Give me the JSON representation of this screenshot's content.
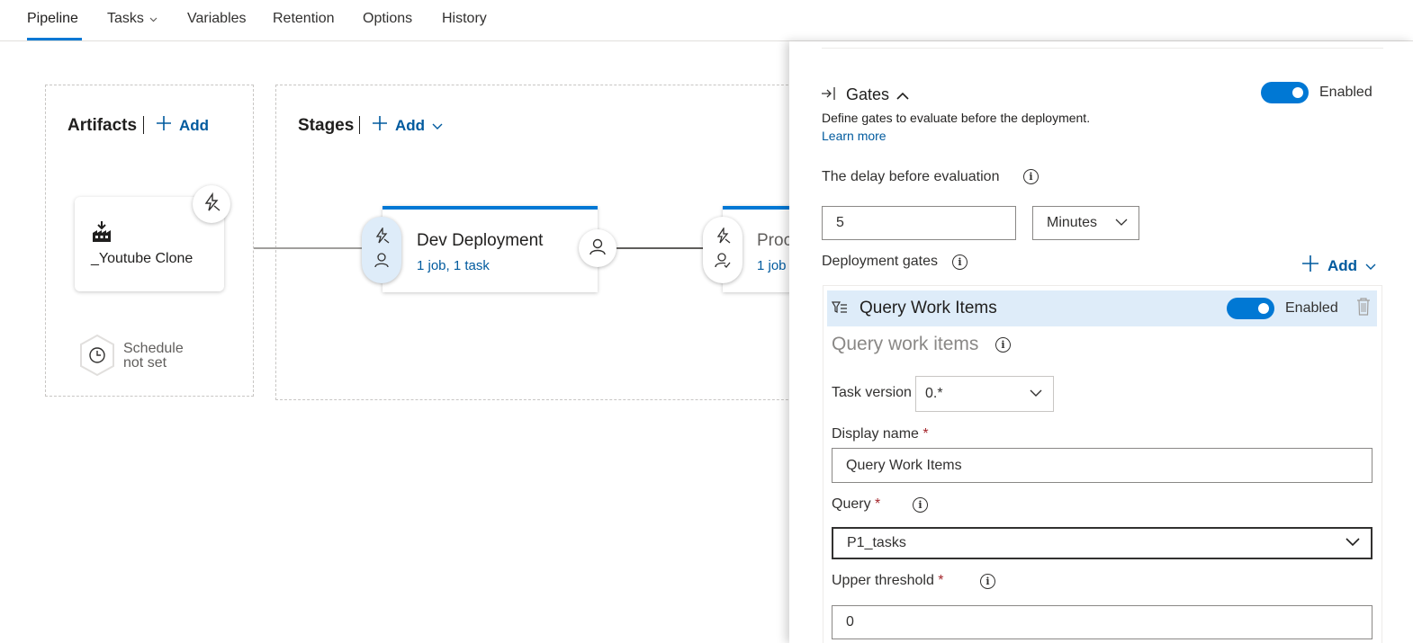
{
  "nav": {
    "tabs": [
      "Pipeline",
      "Tasks",
      "Variables",
      "Retention",
      "Options",
      "History"
    ],
    "active": "Pipeline"
  },
  "artifacts": {
    "heading": "Artifacts",
    "add_label": "Add",
    "artifact_name": "_Youtube Clone",
    "schedule_line1": "Schedule",
    "schedule_line2": "not set"
  },
  "stages": {
    "heading": "Stages",
    "add_label": "Add",
    "items": [
      {
        "name": "Dev Deployment",
        "summary": "1 job, 1 task"
      },
      {
        "name": "Proc",
        "summary": "1 job"
      }
    ]
  },
  "panel": {
    "gates_title": "Gates",
    "gates_toggle_label": "Enabled",
    "gates_description": "Define gates to evaluate before the deployment.",
    "learn_more": "Learn more",
    "delay_label": "The delay before evaluation",
    "delay_value": "5",
    "delay_unit": "Minutes",
    "deployment_gates_label": "Deployment gates",
    "add_label": "Add",
    "gate": {
      "title": "Query Work Items",
      "toggle_label": "Enabled",
      "section_title": "Query work items",
      "task_version_label": "Task version",
      "task_version_value": "0.*",
      "display_name_label": "Display name",
      "display_name_value": "Query Work Items",
      "query_label": "Query",
      "query_value": "P1_tasks",
      "upper_threshold_label": "Upper threshold",
      "upper_threshold_value": "0",
      "required_mark": "*"
    }
  },
  "colors": {
    "accent": "#0078d4",
    "link": "#005a9e",
    "gate_header": "#deecf9",
    "required": "#a4262c"
  }
}
